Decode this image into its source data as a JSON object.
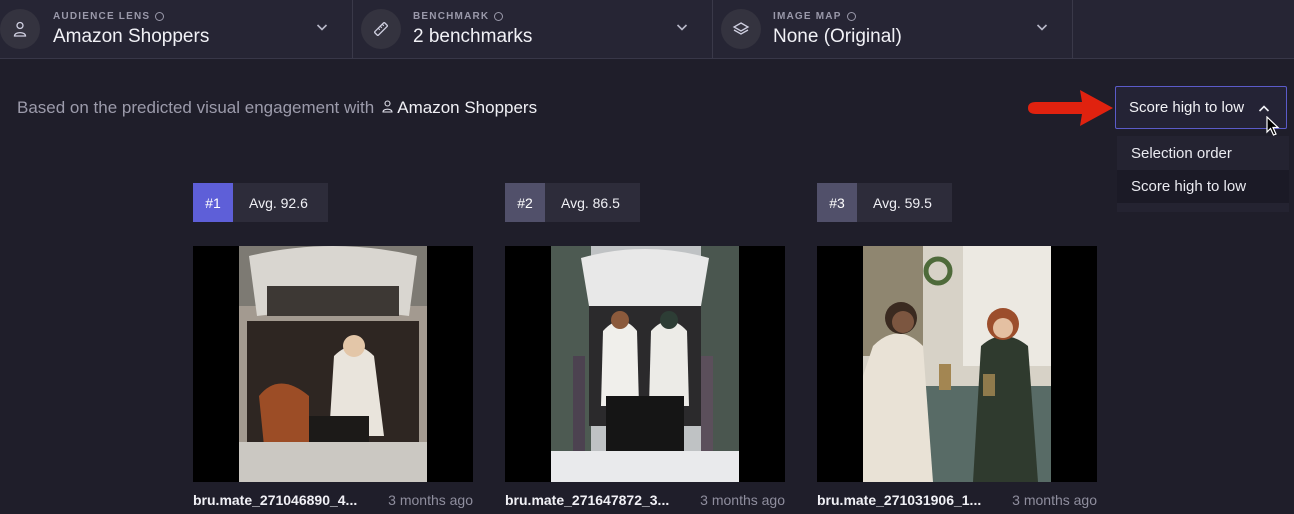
{
  "filters": [
    {
      "label": "AUDIENCE LENS",
      "value": "Amazon Shoppers",
      "icon": "person-icon"
    },
    {
      "label": "BENCHMARK",
      "value": "2 benchmarks",
      "icon": "ruler-icon"
    },
    {
      "label": "IMAGE MAP",
      "value": "None (Original)",
      "icon": "layers-icon"
    }
  ],
  "subtitle": {
    "prefix": "Based on the predicted visual engagement with",
    "audience": "Amazon Shoppers"
  },
  "sort": {
    "selected": "Score high to low",
    "options": [
      "Selection order",
      "Score high to low"
    ]
  },
  "cards": [
    {
      "rank": "#1",
      "avg": "Avg. 92.6",
      "filename": "bru.mate_271046890_4...",
      "age": "3 months ago"
    },
    {
      "rank": "#2",
      "avg": "Avg. 86.5",
      "filename": "bru.mate_271647872_3...",
      "age": "3 months ago"
    },
    {
      "rank": "#3",
      "avg": "Avg. 59.5",
      "filename": "bru.mate_271031906_1...",
      "age": "3 months ago"
    }
  ],
  "colors": {
    "background": "#1f1e2a",
    "accent": "#5e5fd8",
    "annotation_arrow": "#e0220f"
  }
}
